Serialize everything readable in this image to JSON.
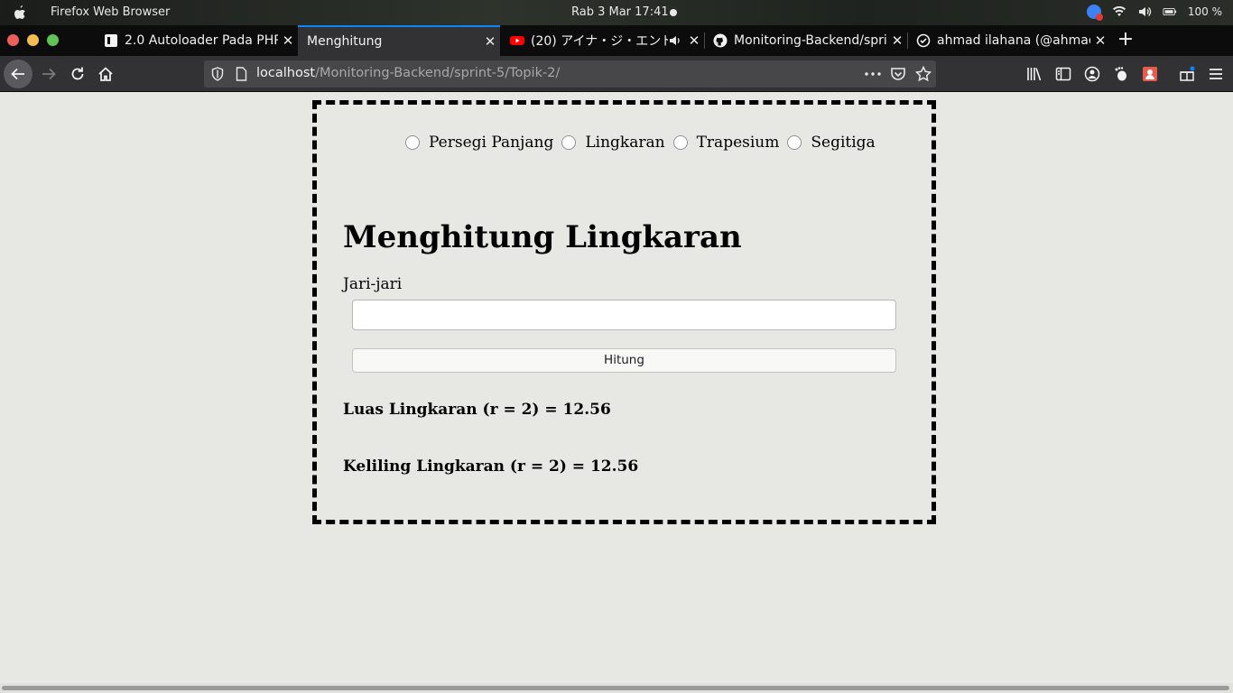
{
  "system_bar": {
    "app_name": "Firefox Web Browser",
    "clock": "Rab  3 Mar  17:41",
    "battery": "100 %"
  },
  "tabs": [
    {
      "title": "2.0 Autoloader Pada PHP",
      "icon": "document-icon"
    },
    {
      "title": "Menghitung",
      "icon": "none",
      "active": true
    },
    {
      "title": "(20) アイナ・ジ・エンド",
      "icon": "youtube-icon"
    },
    {
      "title": "Monitoring-Backend/sprint-5",
      "icon": "github-icon"
    },
    {
      "title": "ahmad ilahana (@ahmad",
      "icon": "threads-icon"
    }
  ],
  "url": {
    "host": "localhost",
    "path": "/Monitoring-Backend/sprint-5/Topik-2/"
  },
  "page": {
    "radio_options": [
      "Persegi Panjang",
      "Lingkaran",
      "Trapesium",
      "Segitiga"
    ],
    "heading": "Menghitung Lingkaran",
    "input_label": "Jari-jari",
    "input_value": "",
    "button_label": "Hitung",
    "result_area": "Luas Lingkaran (r = 2) = 12.56",
    "result_perimeter": "Keliling Lingkaran (r = 2) = 12.56"
  },
  "colors": {
    "page_bg": "#e7e7e3",
    "tab_active_accent": "#0a84ff",
    "toolbar_bg": "#323234",
    "tabstrip_bg": "#0c0c0d"
  }
}
